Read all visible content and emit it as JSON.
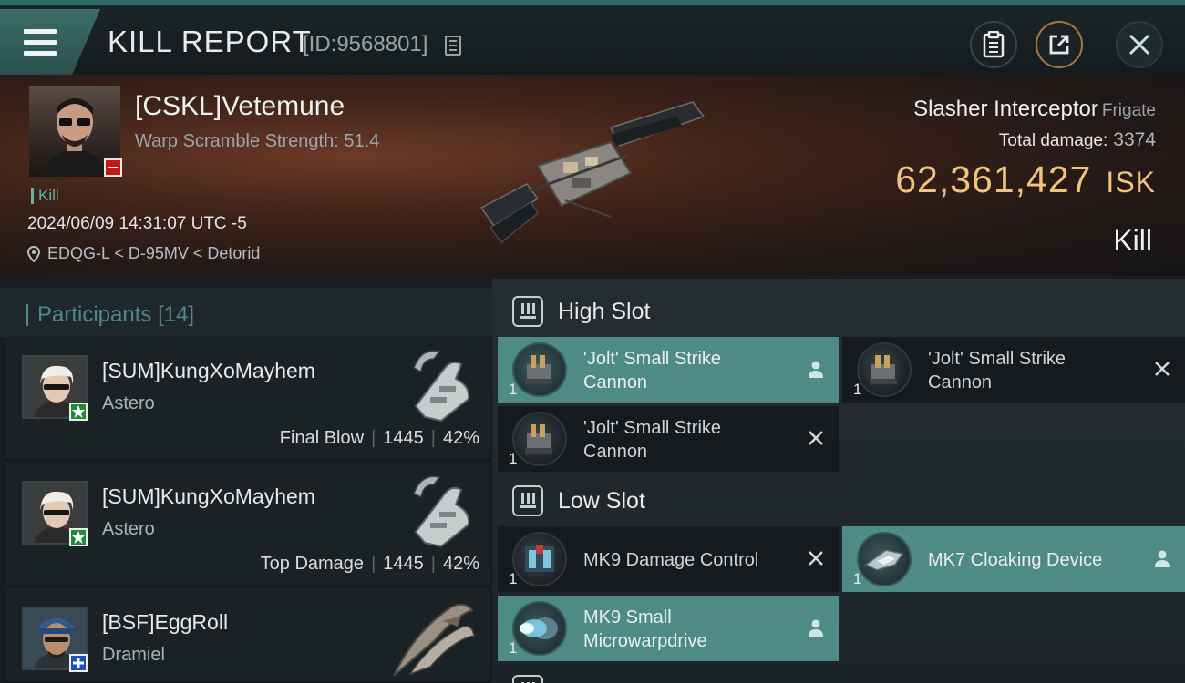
{
  "header": {
    "title": "KILL REPORT",
    "report_id": "[ID:9568801]"
  },
  "victim": {
    "name": "[CSKL]Vetemune",
    "scramble": "Warp Scramble Strength: 51.4",
    "kill_tag": "Kill",
    "datetime": "2024/06/09 14:31:07 UTC -5",
    "location": "EDQG-L < D-95MV < Detorid",
    "ship_name": "Slasher Interceptor",
    "ship_class": "Frigate",
    "total_damage_label": "Total damage:",
    "total_damage": "3374",
    "isk_value": "62,361,427",
    "isk_unit": "ISK",
    "result": "Kill"
  },
  "participants": {
    "title": "Participants",
    "count": "[14]",
    "rows": [
      {
        "name": "[SUM]KungXoMayhem",
        "ship": "Astero",
        "role": "Final Blow",
        "damage": "1445",
        "percent": "42%",
        "badge_color": "#1e8c34"
      },
      {
        "name": "[SUM]KungXoMayhem",
        "ship": "Astero",
        "role": "Top Damage",
        "damage": "1445",
        "percent": "42%",
        "badge_color": "#1e8c34"
      },
      {
        "name": "[BSF]EggRoll",
        "ship": "Dramiel",
        "role": "",
        "damage": "",
        "percent": "",
        "badge_color": "#1f4fb5"
      }
    ]
  },
  "fitting": {
    "high_slot": {
      "label": "High Slot",
      "modules": [
        {
          "line1": "'Jolt' Small Strike",
          "line2": "Cannon",
          "qty": "1",
          "status": "fitted"
        },
        {
          "line1": "'Jolt' Small Strike",
          "line2": "Cannon",
          "qty": "1",
          "status": "destroyed"
        },
        {
          "line1": "'Jolt' Small Strike",
          "line2": "Cannon",
          "qty": "1",
          "status": "destroyed"
        }
      ]
    },
    "low_slot": {
      "label": "Low Slot",
      "modules": [
        {
          "line1": "MK9 Damage Control",
          "line2": "",
          "qty": "1",
          "status": "destroyed"
        },
        {
          "line1": "MK7 Cloaking Device",
          "line2": "",
          "qty": "1",
          "status": "fitted"
        },
        {
          "line1": "MK9 Small",
          "line2": "Microwarpdrive",
          "qty": "1",
          "status": "fitted"
        }
      ]
    }
  },
  "colors": {
    "accent": "#4f8b85",
    "isk": "#f0c47a",
    "minus_badge": "#c11919"
  }
}
